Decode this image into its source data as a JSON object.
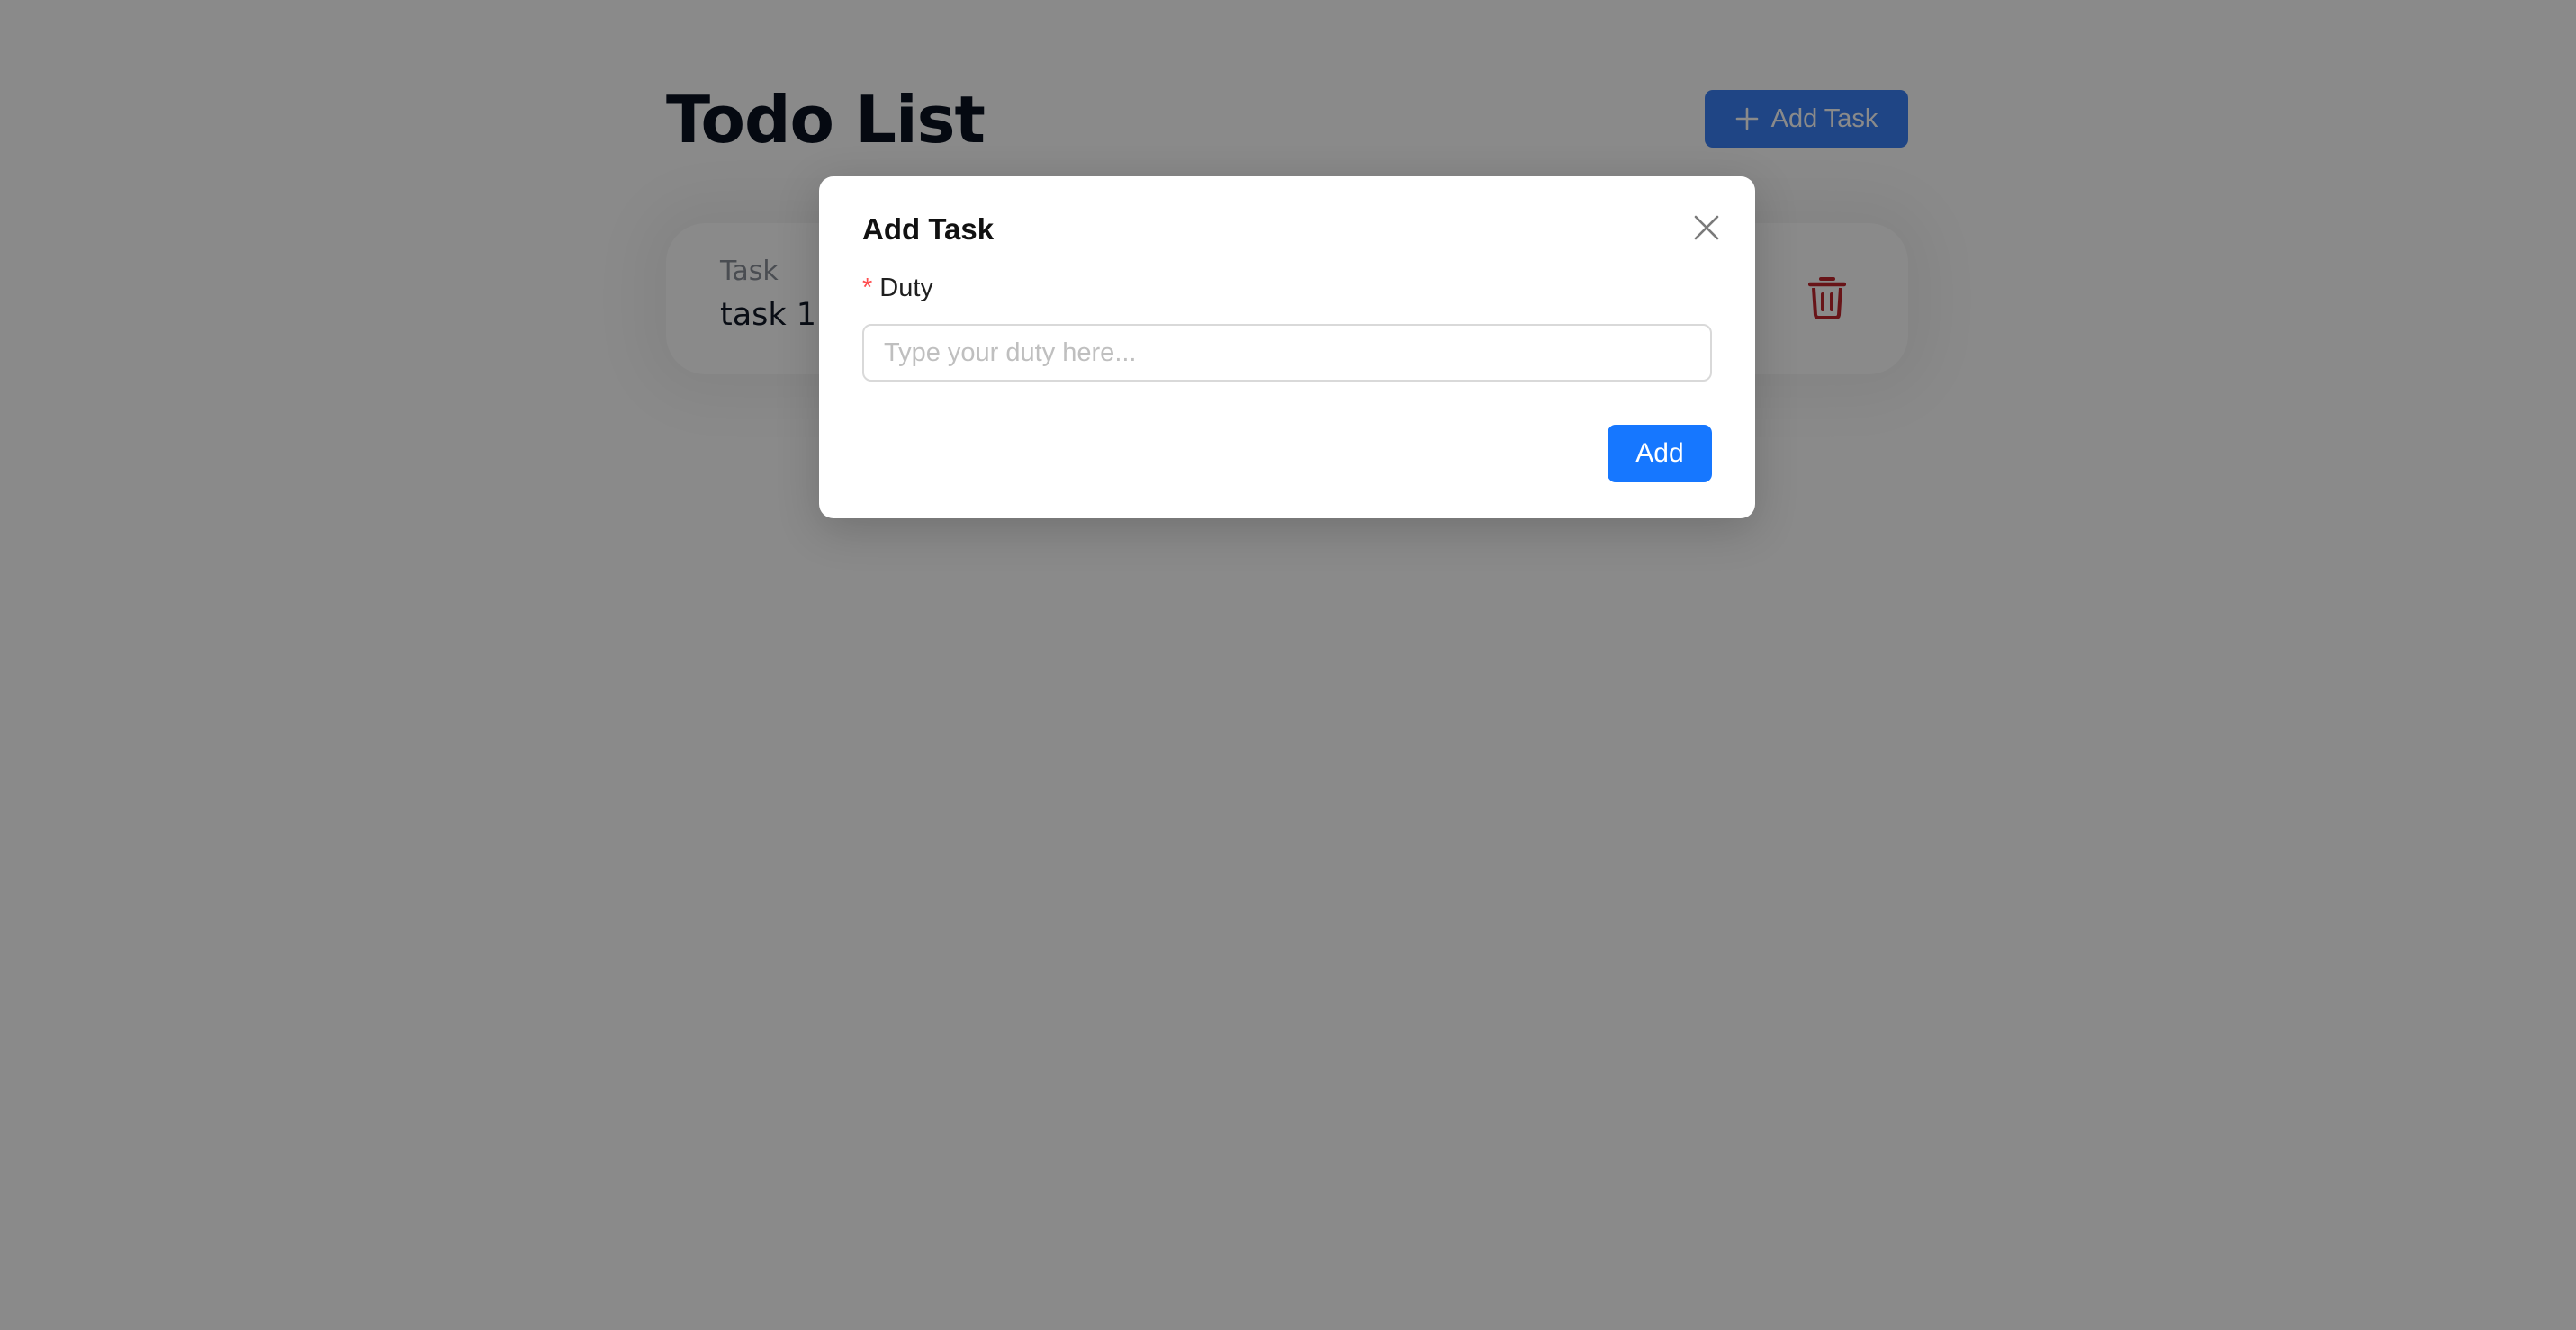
{
  "header": {
    "title": "Todo List",
    "add_button_label": "Add Task"
  },
  "tasks": [
    {
      "label": "Task",
      "value": "task 1"
    }
  ],
  "modal": {
    "title": "Add Task",
    "field": {
      "required_mark": "*",
      "label": "Duty",
      "placeholder": "Type your duty here...",
      "value": ""
    },
    "submit_label": "Add"
  },
  "colors": {
    "primary": "#1677ff",
    "danger": "#c0262d",
    "required": "#ff4d4f",
    "overlay": "rgba(0,0,0,0.46)"
  },
  "icons": {
    "add_button": "plus-icon",
    "task_delete": "trash-icon",
    "modal_close": "close-icon"
  }
}
